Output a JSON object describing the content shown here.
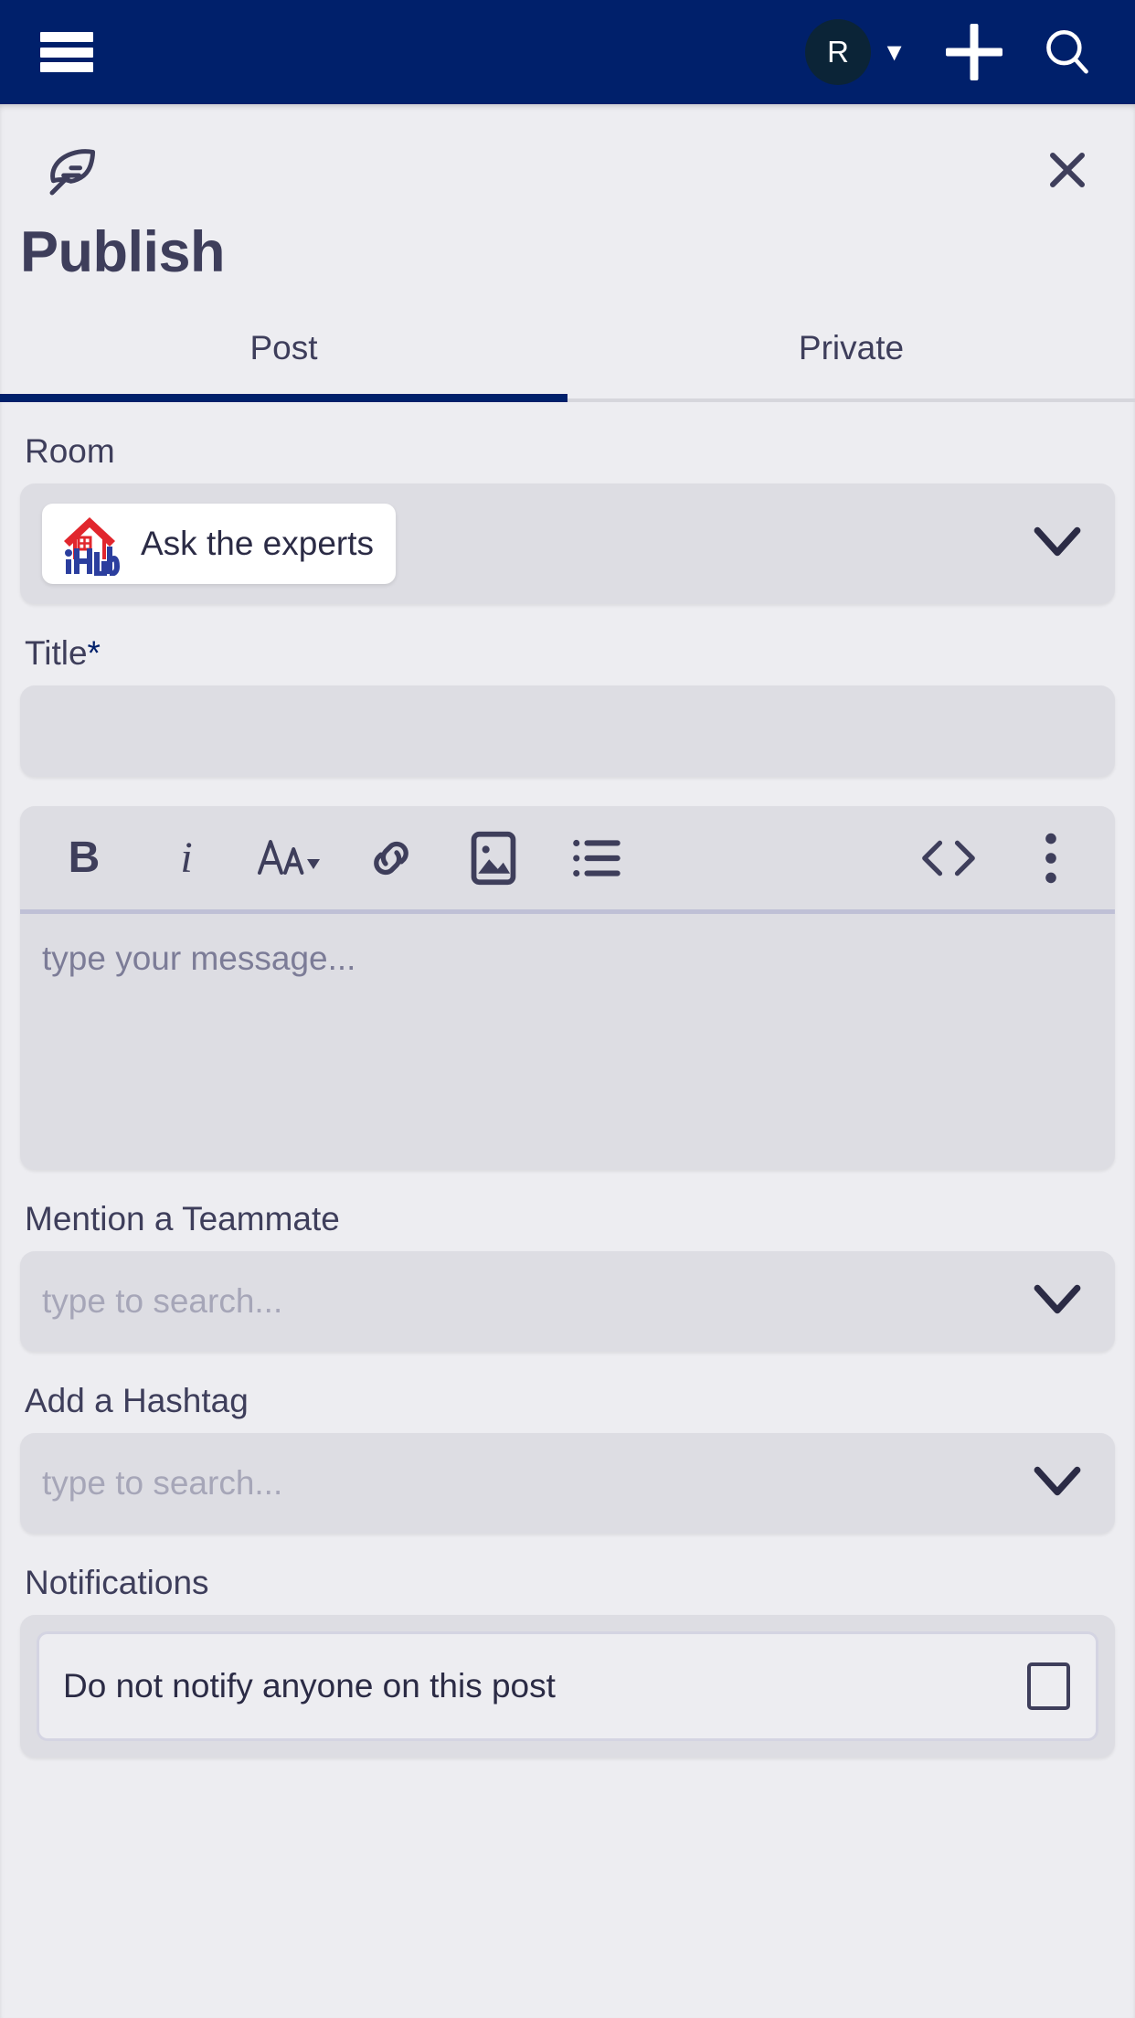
{
  "appbar": {
    "menu_icon": "hamburger-menu-icon",
    "avatar_initial": "R",
    "avatar_caret": "▼",
    "add_icon": "plus-icon",
    "search_icon": "search-icon",
    "background_color": "#00206B"
  },
  "sheet": {
    "compose_icon": "feather-quill-icon",
    "close_icon": "close-x-icon",
    "title": "Publish"
  },
  "tabs": [
    {
      "label": "Post",
      "active": true
    },
    {
      "label": "Private",
      "active": false
    }
  ],
  "form": {
    "room": {
      "label": "Room",
      "selected_chip": "Ask the experts",
      "chip_logo": "ihub-house-logo",
      "chevron": "chevron-down-icon"
    },
    "title": {
      "label": "Title",
      "required_mark": "*",
      "value": "",
      "placeholder": ""
    },
    "editor": {
      "toolbar": [
        {
          "name": "bold-icon",
          "glyph": "B"
        },
        {
          "name": "italic-icon",
          "glyph": "i"
        },
        {
          "name": "font-size-icon",
          "glyph": "Aa"
        },
        {
          "name": "link-icon",
          "glyph": "link"
        },
        {
          "name": "image-icon",
          "glyph": "image"
        },
        {
          "name": "bullet-list-icon",
          "glyph": "list"
        },
        {
          "name": "code-icon",
          "glyph": "<>"
        },
        {
          "name": "more-options-icon",
          "glyph": "⋮"
        }
      ],
      "placeholder": "type your message...",
      "value": ""
    },
    "mention": {
      "label": "Mention a Teammate",
      "placeholder": "type to search...",
      "value": "",
      "chevron": "chevron-down-icon"
    },
    "hashtag": {
      "label": "Add a Hashtag",
      "placeholder": "type to search...",
      "value": "",
      "chevron": "chevron-down-icon"
    },
    "notifications": {
      "label": "Notifications",
      "option_label": "Do not notify anyone on this post",
      "checked": false
    }
  },
  "colors": {
    "appbar": "#00206B",
    "page_bg": "#EDEDF1",
    "field_bg": "#DDDDE3",
    "text_primary": "#3E3E5B",
    "accent": "#00206B",
    "placeholder": "#A6A6B8",
    "logo_red": "#E1262D",
    "logo_blue": "#2B3E9E"
  }
}
